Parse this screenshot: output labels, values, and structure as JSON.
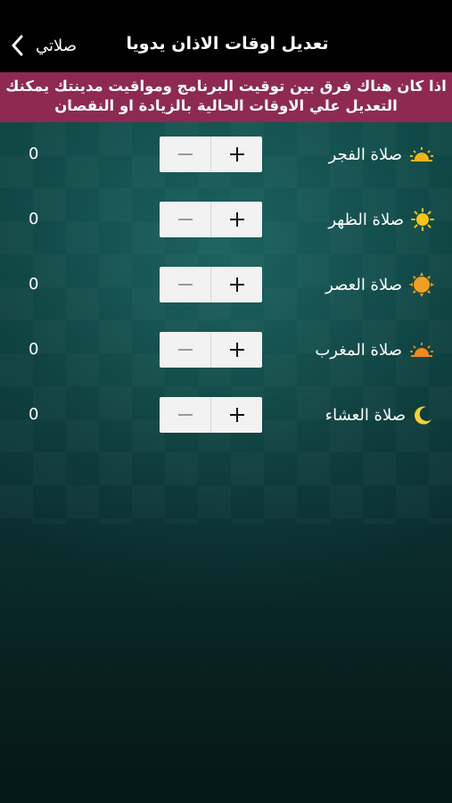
{
  "header": {
    "back_label": "صلاتي",
    "title": "تعديل اوقات الاذان يدويا"
  },
  "notice": {
    "line1": "اذا كان هناك فرق بين توقيت البرنامج ومواقيت مدينتك يمكنك",
    "line2": "التعديل علي الاوقات الحالية بالزيادة او النقصان"
  },
  "stepper_symbols": {
    "minus": "minus-icon",
    "plus": "plus-icon"
  },
  "colors": {
    "notice_bg": "#8e2a52",
    "header_bg": "#000000",
    "icon_gold": "#f2b419"
  },
  "prayers": [
    {
      "name": "صلاة الفجر",
      "value": "0",
      "icon": "sunrise-icon"
    },
    {
      "name": "صلاة الظهر",
      "value": "0",
      "icon": "sun-icon"
    },
    {
      "name": "صلاة العصر",
      "value": "0",
      "icon": "sun-icon"
    },
    {
      "name": "صلاة المغرب",
      "value": "0",
      "icon": "sunset-icon"
    },
    {
      "name": "صلاة العشاء",
      "value": "0",
      "icon": "moon-icon"
    }
  ]
}
